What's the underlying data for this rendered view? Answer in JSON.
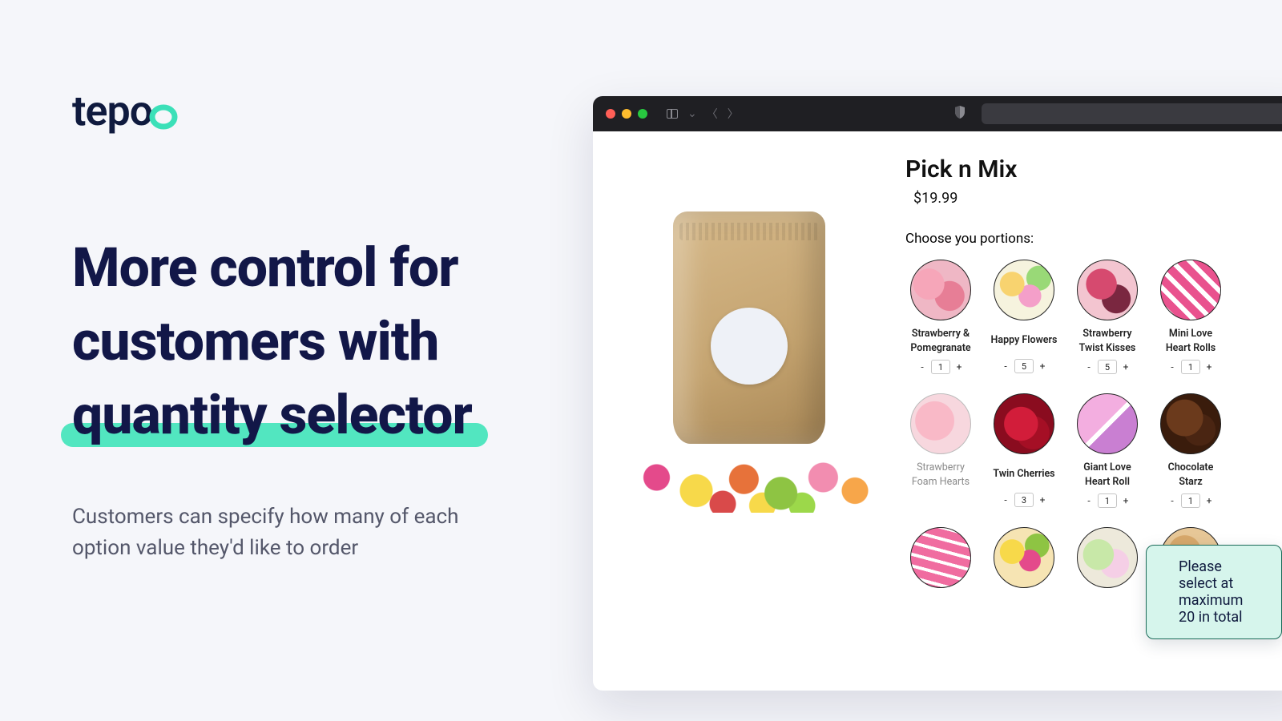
{
  "brand": {
    "name": "tepo"
  },
  "headline": {
    "line1": "More control for",
    "line2": "customers with",
    "highlight": "quantity selector"
  },
  "subhead": "Customers can specify how many of each option value they'd like to order",
  "hint": "Please select at maximum 20 in total",
  "product": {
    "title": "Pick n Mix",
    "price": "$19.99",
    "choose_label": "Choose you portions:",
    "options": [
      {
        "name": "Strawberry & Pomegranate",
        "qty": 1,
        "has_qty": true
      },
      {
        "name": "Happy Flowers",
        "qty": 5,
        "has_qty": true
      },
      {
        "name": "Strawberry Twist Kisses",
        "qty": 5,
        "has_qty": true
      },
      {
        "name": "Mini Love Heart Rolls",
        "qty": 1,
        "has_qty": true
      },
      {
        "name": "Strawberry Foam Hearts",
        "qty": 0,
        "has_qty": false,
        "dim": true
      },
      {
        "name": "Twin Cherries",
        "qty": 3,
        "has_qty": true
      },
      {
        "name": "Giant Love Heart Roll",
        "qty": 1,
        "has_qty": true
      },
      {
        "name": "Chocolate Starz",
        "qty": 1,
        "has_qty": true
      },
      {
        "name": "",
        "qty": 0,
        "has_qty": false
      },
      {
        "name": "",
        "qty": 0,
        "has_qty": false
      },
      {
        "name": "",
        "qty": 0,
        "has_qty": false
      },
      {
        "name": "",
        "qty": 0,
        "has_qty": false
      }
    ]
  }
}
